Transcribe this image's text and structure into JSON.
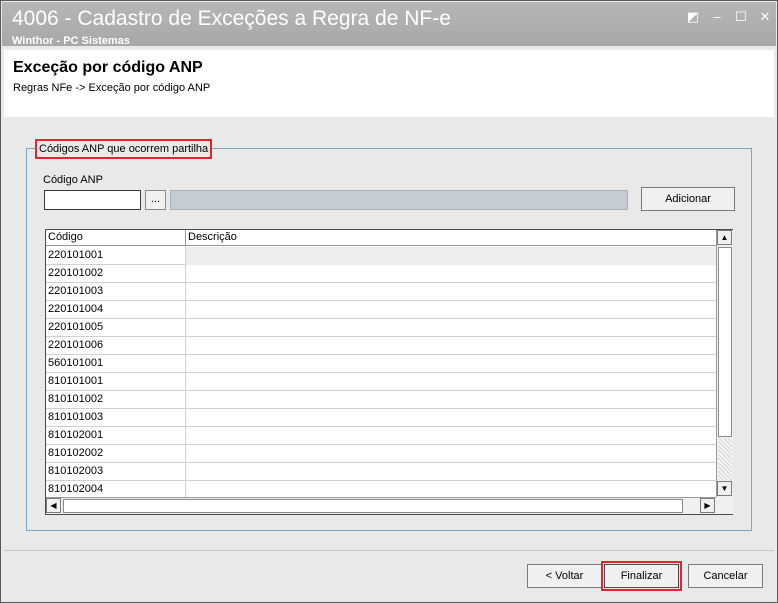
{
  "window": {
    "title": "4006 - Cadastro de Exceções a Regra de NF-e",
    "subtitle": "Winthor - PC Sistemas",
    "controls": {
      "restore": "◩",
      "minimize": "–",
      "maximize": "☐",
      "close": "✕"
    }
  },
  "header": {
    "title": "Exceção por código ANP",
    "breadcrumb": "Regras NFe -> Exceção por código ANP"
  },
  "group": {
    "label": "Códigos ANP que ocorrem partilha",
    "field_label": "Código ANP",
    "code_value": "",
    "lookup_label": "...",
    "description_value": "",
    "add_label": "Adicionar"
  },
  "grid": {
    "columns": [
      "Código",
      "Descrição"
    ],
    "rows": [
      {
        "code": "220101001",
        "description": ""
      },
      {
        "code": "220101002",
        "description": ""
      },
      {
        "code": "220101003",
        "description": ""
      },
      {
        "code": "220101004",
        "description": ""
      },
      {
        "code": "220101005",
        "description": ""
      },
      {
        "code": "220101006",
        "description": ""
      },
      {
        "code": "560101001",
        "description": ""
      },
      {
        "code": "810101001",
        "description": ""
      },
      {
        "code": "810101002",
        "description": ""
      },
      {
        "code": "810101003",
        "description": ""
      },
      {
        "code": "810102001",
        "description": ""
      },
      {
        "code": "810102002",
        "description": ""
      },
      {
        "code": "810102003",
        "description": ""
      },
      {
        "code": "810102004",
        "description": ""
      }
    ],
    "scroll": {
      "up": "▲",
      "down": "▼",
      "left": "◀",
      "right": "▶"
    }
  },
  "footer": {
    "back_label": "< Voltar",
    "finish_label": "Finalizar",
    "cancel_label": "Cancelar"
  },
  "colors": {
    "highlight": "#e8232a",
    "titlebar": "#aeaeae",
    "groupbox_border": "#7aa6c8"
  }
}
